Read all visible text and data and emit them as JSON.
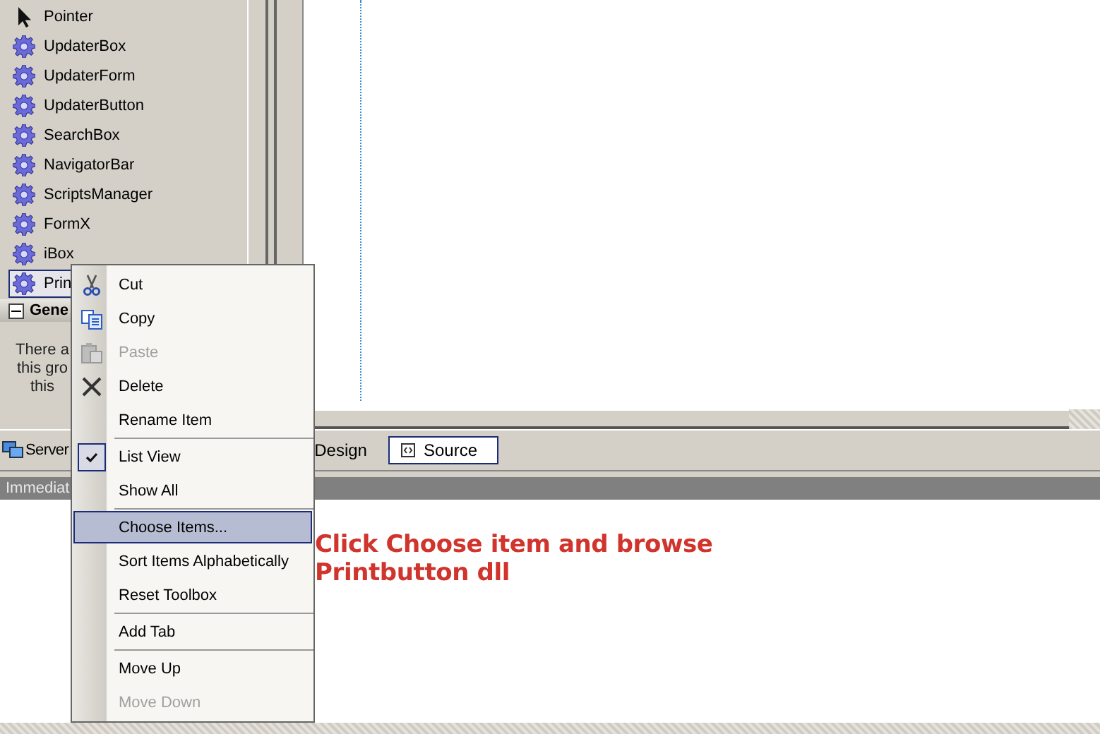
{
  "toolbox": {
    "items": [
      {
        "label": "Pointer",
        "kind": "pointer",
        "selected": false
      },
      {
        "label": "UpdaterBox",
        "kind": "component",
        "selected": false
      },
      {
        "label": "UpdaterForm",
        "kind": "component",
        "selected": false
      },
      {
        "label": "UpdaterButton",
        "kind": "component",
        "selected": false
      },
      {
        "label": "SearchBox",
        "kind": "component",
        "selected": false
      },
      {
        "label": "NavigatorBar",
        "kind": "component",
        "selected": false
      },
      {
        "label": "ScriptsManager",
        "kind": "component",
        "selected": false
      },
      {
        "label": "FormX",
        "kind": "component",
        "selected": false
      },
      {
        "label": "iBox",
        "kind": "component",
        "selected": false
      },
      {
        "label": "Prin",
        "kind": "component",
        "selected": true
      }
    ],
    "group": {
      "title": "Gene",
      "expanded": true,
      "message_lines": [
        "There a",
        "this gro",
        "this"
      ]
    }
  },
  "bottom_tabs": [
    {
      "label": "Server",
      "selected": false
    }
  ],
  "view_tabs": [
    {
      "label": "Design",
      "selected": false
    },
    {
      "label": "Source",
      "selected": true
    }
  ],
  "immediate": {
    "title": "Immediat"
  },
  "annotation": [
    "Click Choose item and browse",
    "Printbutton dll"
  ],
  "context_menu": [
    {
      "kind": "item",
      "label": "Cut",
      "disabled": false,
      "checked": false,
      "selected": false
    },
    {
      "kind": "item",
      "label": "Copy",
      "disabled": false,
      "checked": false,
      "selected": false
    },
    {
      "kind": "item",
      "label": "Paste",
      "disabled": true,
      "checked": false,
      "selected": false
    },
    {
      "kind": "item",
      "label": "Delete",
      "disabled": false,
      "checked": false,
      "selected": false
    },
    {
      "kind": "item",
      "label": "Rename Item",
      "disabled": false,
      "checked": false,
      "selected": false
    },
    {
      "kind": "separator"
    },
    {
      "kind": "item",
      "label": "List View",
      "disabled": false,
      "checked": true,
      "selected": false
    },
    {
      "kind": "item",
      "label": "Show All",
      "disabled": false,
      "checked": false,
      "selected": false
    },
    {
      "kind": "separator"
    },
    {
      "kind": "item",
      "label": "Choose Items...",
      "disabled": false,
      "checked": false,
      "selected": true
    },
    {
      "kind": "item",
      "label": "Sort Items Alphabetically",
      "disabled": false,
      "checked": false,
      "selected": false
    },
    {
      "kind": "item",
      "label": "Reset Toolbox",
      "disabled": false,
      "checked": false,
      "selected": false
    },
    {
      "kind": "separator"
    },
    {
      "kind": "item",
      "label": "Add Tab",
      "disabled": false,
      "checked": false,
      "selected": false
    },
    {
      "kind": "separator"
    },
    {
      "kind": "item",
      "label": "Move Up",
      "disabled": false,
      "checked": false,
      "selected": false
    },
    {
      "kind": "item",
      "label": "Move Down",
      "disabled": true,
      "checked": false,
      "selected": false
    }
  ]
}
